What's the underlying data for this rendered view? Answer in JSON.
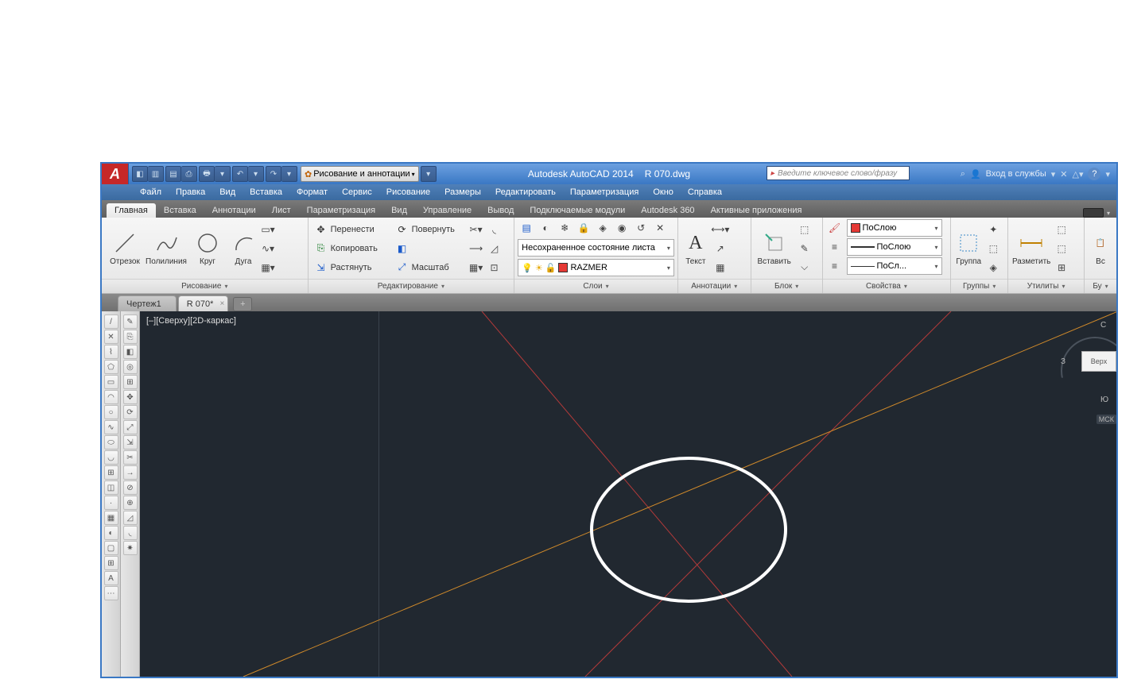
{
  "title": {
    "app": "Autodesk AutoCAD 2014",
    "file": "R 070.dwg"
  },
  "search_placeholder": "Введите ключевое слово/фразу",
  "signin": "Вход в службы",
  "workspace": "Рисование и аннотации",
  "menubar": [
    "Файл",
    "Правка",
    "Вид",
    "Вставка",
    "Формат",
    "Сервис",
    "Рисование",
    "Размеры",
    "Редактировать",
    "Параметризация",
    "Окно",
    "Справка"
  ],
  "ribbon_tabs": [
    "Главная",
    "Вставка",
    "Аннотации",
    "Лист",
    "Параметризация",
    "Вид",
    "Управление",
    "Вывод",
    "Подключаемые модули",
    "Autodesk 360",
    "Активные приложения"
  ],
  "panels": {
    "draw": {
      "title": "Рисование",
      "b": [
        "Отрезок",
        "Полилиния",
        "Круг",
        "Дуга"
      ]
    },
    "modify": {
      "title": "Редактирование",
      "c1": [
        "Перенести",
        "Копировать",
        "Растянуть"
      ],
      "c2": [
        "Повернуть",
        "Зеркало",
        "Масштаб"
      ]
    },
    "layers": {
      "title": "Слои",
      "state": "Несохраненное состояние листа",
      "current": "RAZMER"
    },
    "annot": {
      "title": "Аннотации",
      "text": "Текст"
    },
    "block": {
      "title": "Блок",
      "insert": "Вставить"
    },
    "props": {
      "title": "Свойства",
      "bycolor": "ПоСлою",
      "bylt": "ПоСлою",
      "bylw": "ПоСл..."
    },
    "groups": {
      "title": "Группы",
      "btn": "Группа"
    },
    "utils": {
      "title": "Утилиты",
      "btn": "Разметить"
    },
    "clip": {
      "title": "Бу",
      "btn": "Вс"
    }
  },
  "filetabs": {
    "t1": "Чертеж1",
    "t2": "R 070*"
  },
  "viewport": {
    "label": "[–][Сверху][2D-каркас]",
    "cube": "Верх",
    "w": "З",
    "s": "С",
    "south": "Ю",
    "csys": "МСК"
  }
}
